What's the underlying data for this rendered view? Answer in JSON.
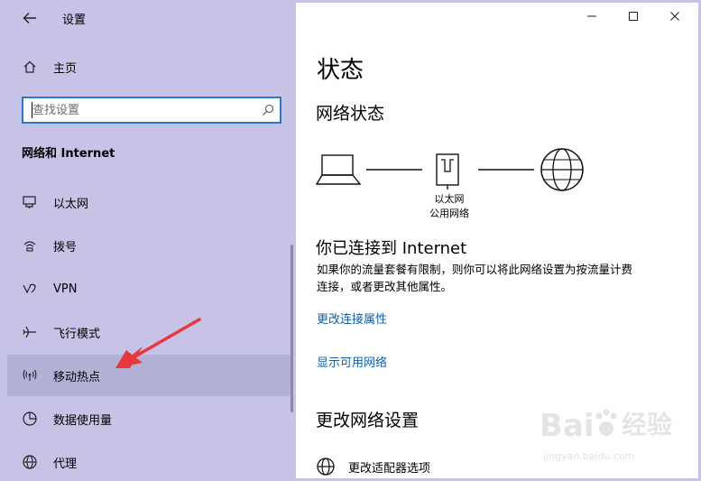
{
  "window": {
    "app_title": "设置",
    "controls": {
      "minimize_icon": "minimize-icon",
      "maximize_icon": "maximize-icon",
      "close_icon": "close-icon"
    }
  },
  "sidebar": {
    "home_label": "主页",
    "search": {
      "placeholder": "查找设置",
      "value": ""
    },
    "section_heading": "网络和 Internet",
    "items": [
      {
        "id": "ethernet",
        "label": "以太网",
        "icon": "ethernet-icon"
      },
      {
        "id": "dialup",
        "label": "拨号",
        "icon": "dialup-icon"
      },
      {
        "id": "vpn",
        "label": "VPN",
        "icon": "vpn-icon"
      },
      {
        "id": "airplane",
        "label": "飞行模式",
        "icon": "airplane-icon"
      },
      {
        "id": "hotspot",
        "label": "移动热点",
        "icon": "hotspot-icon",
        "selected": true
      },
      {
        "id": "data",
        "label": "数据使用量",
        "icon": "data-usage-icon"
      },
      {
        "id": "proxy",
        "label": "代理",
        "icon": "globe-icon"
      }
    ]
  },
  "main": {
    "page_title": "状态",
    "network_status_heading": "网络状态",
    "diagram": {
      "adapter_label": "以太网",
      "network_type": "公用网络"
    },
    "connected_heading": "你已连接到 Internet",
    "connected_desc_line1": "如果你的流量套餐有限制，则你可以将此网络设置为按流量计费",
    "connected_desc_line2": "连接，或者更改其他属性。",
    "links": {
      "change_properties": "更改连接属性",
      "show_networks": "显示可用网络"
    },
    "change_settings_heading": "更改网络设置",
    "adapter_options_label": "更改适配器选项"
  },
  "watermark": {
    "brand": "Bai 经验",
    "url": "jingyan.baidu.com"
  },
  "colors": {
    "sidebar_bg": "#c6c3e6",
    "selected_bg": "#b3b1d6",
    "accent": "#2b78c8",
    "link": "#0f5ea8",
    "annotation_arrow": "#e8383d"
  }
}
